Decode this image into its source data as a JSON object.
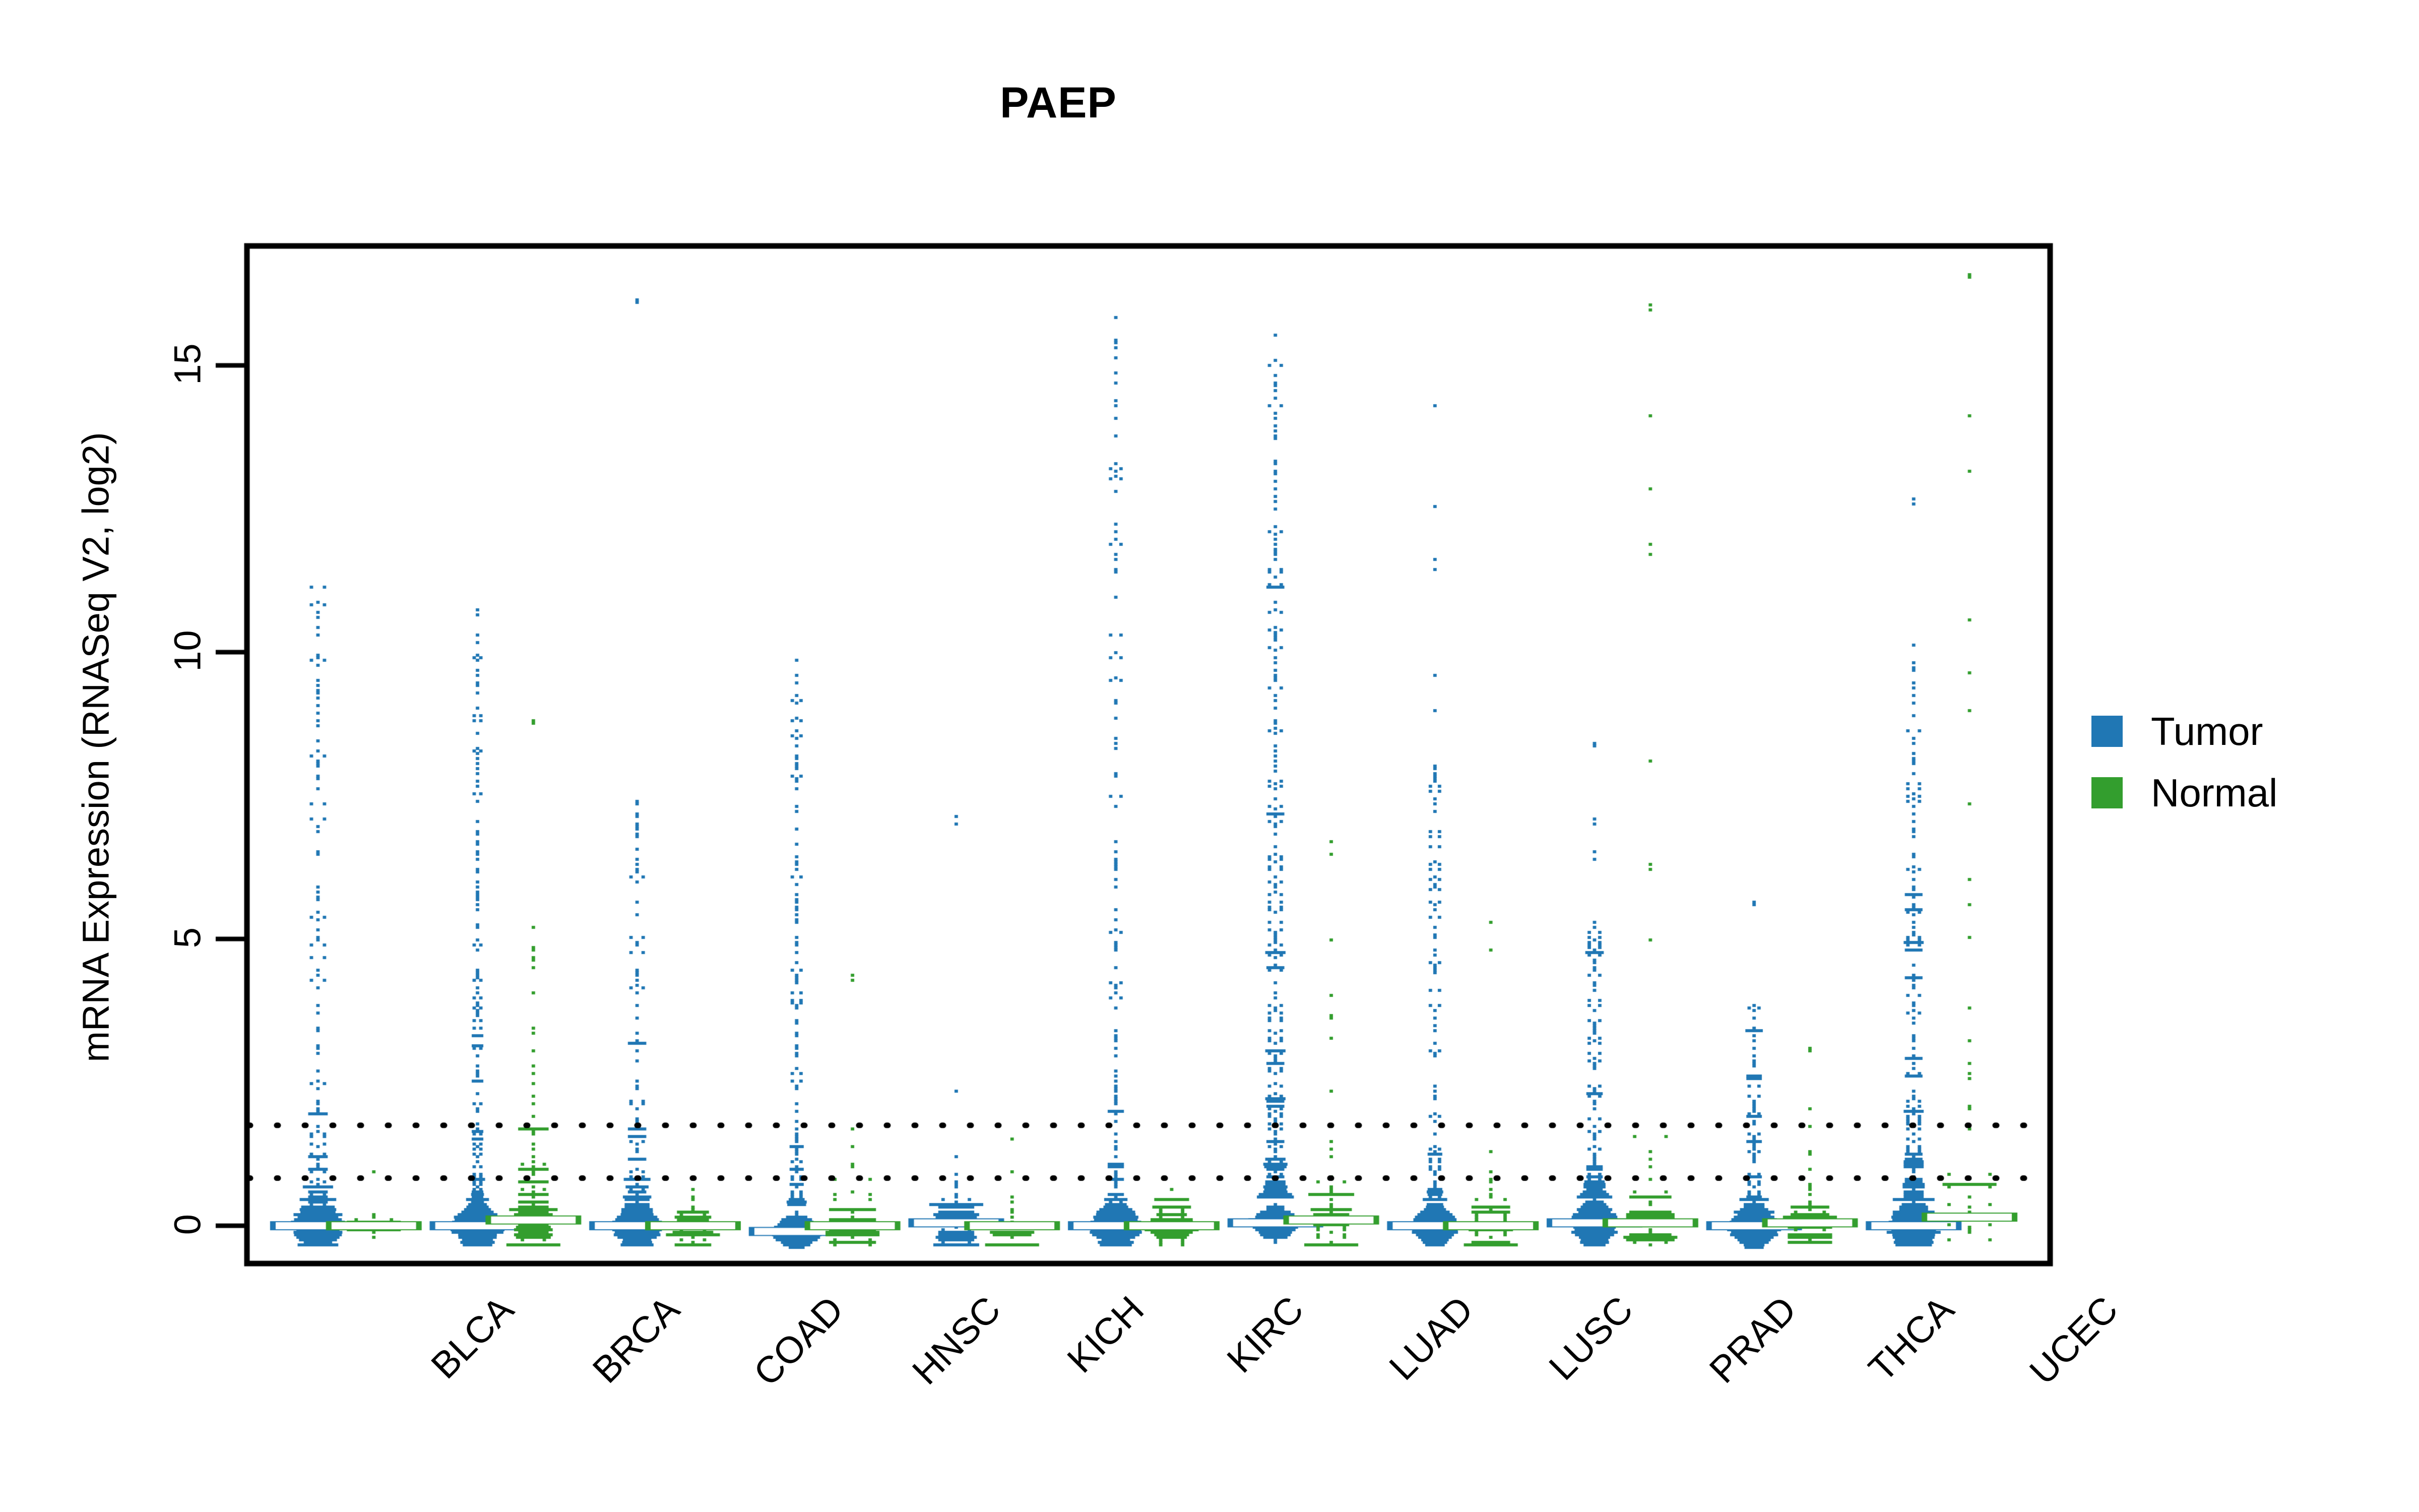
{
  "chart_data": {
    "type": "beeswarm",
    "title": "PAEP",
    "xlabel": "",
    "ylabel": "mRNA Expression (RNASeq V2, log2)",
    "ylim": [
      -1.1,
      17.0
    ],
    "yticks": [
      0,
      5,
      10,
      15
    ],
    "ytick_labels": [
      "0",
      "5",
      "10",
      "15"
    ],
    "grid": false,
    "legend_position": "right",
    "reference_lines": [
      1.75,
      0.83
    ],
    "reference_line_style": "dotted",
    "categories": [
      "BLCA",
      "BRCA",
      "COAD",
      "HNSC",
      "KICH",
      "KIRC",
      "LUAD",
      "LUSC",
      "PRAD",
      "THCA",
      "UCEC"
    ],
    "series": [
      {
        "name": "Tumor",
        "color": "#2077B4"
      },
      {
        "name": "Normal",
        "color": "#339E2E"
      }
    ],
    "groups": [
      {
        "category": "BLCA",
        "tumor": {
          "n": 408,
          "median": 0.0,
          "min": -0.35,
          "max": 11.15,
          "core_sd": 0.34,
          "tail_frac": 0.3,
          "tail_top": 11.15,
          "outliers": [
            11.15,
            10.6,
            10.3,
            9.95,
            9.75,
            9.5,
            9.2,
            8.95
          ]
        },
        "normal": {
          "n": 19,
          "median": 0.0,
          "min": -0.35,
          "max": 0.95,
          "core_sd": 0.3,
          "tail_frac": 0.04,
          "tail_top": 1.0,
          "outliers": []
        }
      },
      {
        "category": "BRCA",
        "tumor": {
          "n": 1100,
          "median": 0.0,
          "min": -0.35,
          "max": 10.75,
          "core_sd": 0.28,
          "tail_frac": 0.14,
          "tail_top": 10.75,
          "outliers": [
            10.75,
            10.3,
            10.15,
            9.6,
            9.3,
            8.9,
            8.6
          ]
        },
        "normal": {
          "n": 112,
          "median": 0.1,
          "min": -0.35,
          "max": 8.8,
          "core_sd": 0.55,
          "tail_frac": 0.3,
          "tail_top": 5.5,
          "outliers": [
            8.8,
            8.75
          ]
        }
      },
      {
        "category": "COAD",
        "tumor": {
          "n": 382,
          "median": 0.0,
          "min": -0.35,
          "max": 16.15,
          "core_sd": 0.33,
          "tail_frac": 0.26,
          "tail_top": 7.6,
          "outliers": [
            16.15,
            16.1
          ]
        },
        "normal": {
          "n": 51,
          "median": 0.0,
          "min": -0.35,
          "max": 1.0,
          "core_sd": 0.3,
          "tail_frac": 0.05,
          "tail_top": 1.0,
          "outliers": []
        }
      },
      {
        "category": "HNSC",
        "tumor": {
          "n": 520,
          "median": -0.1,
          "min": -0.4,
          "max": 9.85,
          "core_sd": 0.22,
          "tail_frac": 0.24,
          "tail_top": 9.85,
          "outliers": [
            9.85,
            9.6,
            9.25,
            8.2,
            8.0,
            7.8
          ]
        },
        "normal": {
          "n": 44,
          "median": 0.0,
          "min": -0.35,
          "max": 4.35,
          "core_sd": 0.42,
          "tail_frac": 0.18,
          "tail_top": 2.3,
          "outliers": [
            4.35,
            4.3
          ]
        }
      },
      {
        "category": "KICH",
        "tumor": {
          "n": 66,
          "median": 0.05,
          "min": -0.35,
          "max": 7.15,
          "core_sd": 0.48,
          "tail_frac": 0.1,
          "tail_top": 2.6,
          "outliers": [
            7.15,
            7.0
          ]
        },
        "normal": {
          "n": 25,
          "median": 0.0,
          "min": -0.35,
          "max": 3.15,
          "core_sd": 0.4,
          "tail_frac": 0.12,
          "tail_top": 3.15,
          "outliers": []
        }
      },
      {
        "category": "KIRC",
        "tumor": {
          "n": 533,
          "median": 0.0,
          "min": -0.35,
          "max": 15.85,
          "core_sd": 0.3,
          "tail_frac": 0.22,
          "tail_top": 15.85,
          "outliers": [
            15.85,
            14.3,
            13.3,
            13.05,
            12.8,
            11.9,
            10.3,
            9.1,
            8.3
          ]
        },
        "normal": {
          "n": 72,
          "median": 0.0,
          "min": -0.35,
          "max": 1.0,
          "core_sd": 0.32,
          "tail_frac": 0.06,
          "tail_top": 1.0,
          "outliers": []
        }
      },
      {
        "category": "LUAD",
        "tumor": {
          "n": 517,
          "median": 0.05,
          "min": -0.4,
          "max": 15.9,
          "core_sd": 0.22,
          "tail_frac": 0.6,
          "tail_top": 15.9,
          "outliers": []
        },
        "normal": {
          "n": 59,
          "median": 0.1,
          "min": -0.35,
          "max": 6.9,
          "core_sd": 0.55,
          "tail_frac": 0.32,
          "tail_top": 6.9,
          "outliers": []
        }
      },
      {
        "category": "LUSC",
        "tumor": {
          "n": 501,
          "median": 0.0,
          "min": -0.35,
          "max": 14.3,
          "core_sd": 0.26,
          "tail_frac": 0.22,
          "tail_top": 8.0,
          "outliers": [
            14.3,
            12.55,
            11.6,
            11.45,
            9.6,
            9.0,
            8.0
          ]
        },
        "normal": {
          "n": 51,
          "median": 0.0,
          "min": -0.35,
          "max": 5.3,
          "core_sd": 0.38,
          "tail_frac": 0.18,
          "tail_top": 2.7,
          "outliers": [
            5.3,
            4.8
          ]
        }
      },
      {
        "category": "PRAD",
        "tumor": {
          "n": 498,
          "median": 0.05,
          "min": -0.35,
          "max": 8.4,
          "core_sd": 0.32,
          "tail_frac": 0.3,
          "tail_top": 5.4,
          "outliers": [
            8.4,
            8.35,
            7.1,
            7.0,
            6.5,
            6.4
          ]
        },
        "normal": {
          "n": 52,
          "median": 0.05,
          "min": -0.35,
          "max": 16.05,
          "core_sd": 0.4,
          "tail_frac": 0.16,
          "tail_top": 3.2,
          "outliers": [
            16.05,
            15.95,
            14.1,
            12.85,
            11.9,
            11.7,
            8.1,
            6.3,
            6.2,
            5.0
          ]
        }
      },
      {
        "category": "THCA",
        "tumor": {
          "n": 509,
          "median": 0.0,
          "min": -0.4,
          "max": 5.65,
          "core_sd": 0.28,
          "tail_frac": 0.16,
          "tail_top": 3.8,
          "outliers": [
            5.65,
            5.6,
            3.85,
            3.8,
            3.4
          ]
        },
        "normal": {
          "n": 59,
          "median": 0.05,
          "min": -0.35,
          "max": 3.1,
          "core_sd": 0.36,
          "tail_frac": 0.16,
          "tail_top": 2.6,
          "outliers": [
            3.1,
            3.05
          ]
        }
      },
      {
        "category": "UCEC",
        "tumor": {
          "n": 545,
          "median": 0.0,
          "min": -0.35,
          "max": 12.65,
          "core_sd": 0.34,
          "tail_frac": 0.38,
          "tail_top": 10.6,
          "outliers": [
            12.65,
            12.6
          ]
        },
        "normal": {
          "n": 35,
          "median": 0.15,
          "min": -0.35,
          "max": 16.6,
          "core_sd": 0.6,
          "tail_frac": 0.55,
          "tail_top": 11.0,
          "outliers": [
            16.6,
            16.55,
            14.1,
            13.15
          ]
        }
      }
    ]
  },
  "legend": {
    "items": [
      {
        "label": "Tumor",
        "color": "#2077B4"
      },
      {
        "label": "Normal",
        "color": "#339E2E"
      }
    ]
  },
  "axes": {
    "y_title": "mRNA Expression (RNASeq V2, log2)",
    "y_labels": [
      "0",
      "5",
      "10",
      "15"
    ],
    "x_labels": [
      "BLCA",
      "BRCA",
      "COAD",
      "HNSC",
      "KICH",
      "KIRC",
      "LUAD",
      "LUSC",
      "PRAD",
      "THCA",
      "UCEC"
    ]
  },
  "colors": {
    "tumor": "#2077B4",
    "normal": "#339E2E",
    "axis": "#000000",
    "background": "#ffffff",
    "reference_line": "#000000",
    "median_line": "#ffffff"
  }
}
